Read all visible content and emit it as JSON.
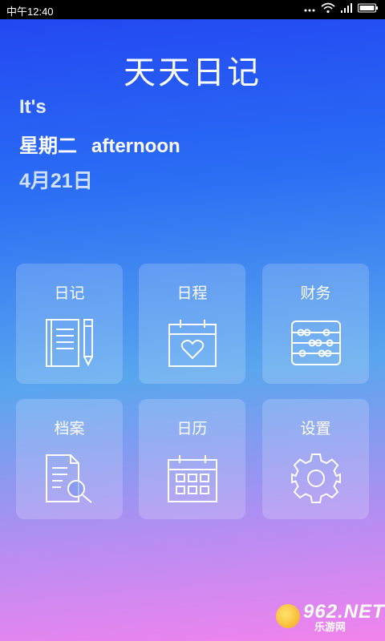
{
  "status_bar": {
    "time": "中午12:40"
  },
  "app": {
    "title": "天天日记"
  },
  "greeting": {
    "intro": "It's",
    "weekday": "星期二",
    "period": "afternoon",
    "date": "4月21日"
  },
  "tiles": [
    {
      "label": "日记",
      "icon": "notebook-pen-icon"
    },
    {
      "label": "日程",
      "icon": "calendar-heart-icon"
    },
    {
      "label": "财务",
      "icon": "abacus-icon"
    },
    {
      "label": "档案",
      "icon": "document-search-icon"
    },
    {
      "label": "日历",
      "icon": "calendar-grid-icon"
    },
    {
      "label": "设置",
      "icon": "gear-icon"
    }
  ],
  "watermark": {
    "brand": "962.NET",
    "sub": "乐游网"
  }
}
